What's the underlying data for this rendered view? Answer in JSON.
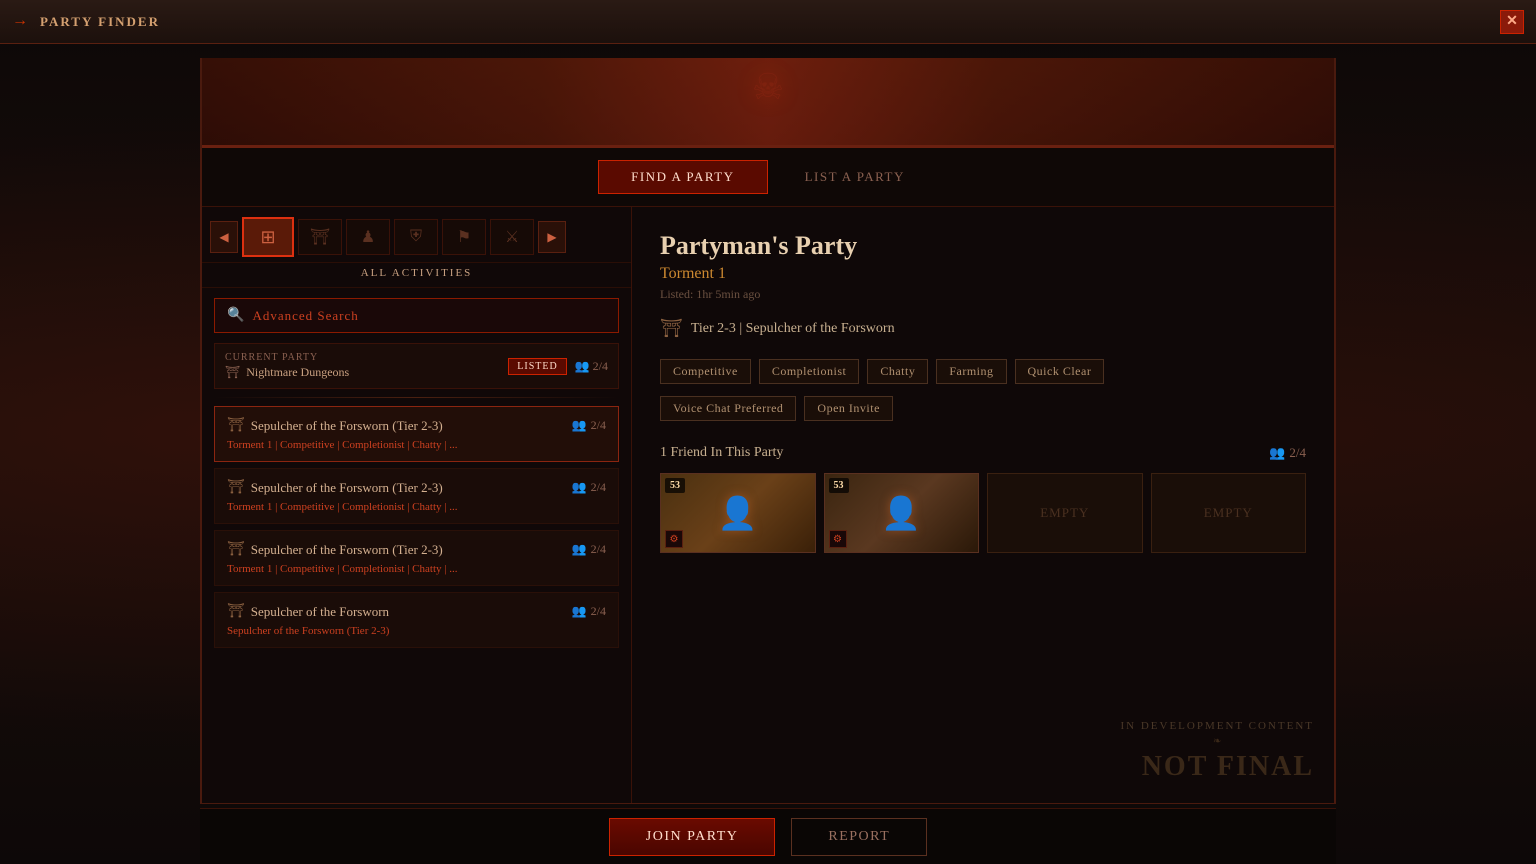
{
  "window": {
    "title": "PARTY FINDER",
    "title_icon": "→"
  },
  "tabs": {
    "find": "FIND A PARTY",
    "list": "LIST A PARTY",
    "active": "find"
  },
  "left_panel": {
    "activity_label": "ALL ACTIVITIES",
    "search_placeholder": "Advanced Search",
    "current_party": {
      "label": "Current Party",
      "name": "Nightmare Dungeons",
      "status": "LISTED",
      "count": "2/4"
    },
    "nav_icons": [
      "◀",
      "⊞",
      "⛩",
      "☗",
      "♟",
      "⚑",
      "⚔",
      "▶"
    ],
    "party_list": [
      {
        "name": "Sepulcher of the Forsworn (Tier 2-3)",
        "count": "2/4",
        "tags": "Torment 1  |  Competitive  |  Completionist  |  Chatty  |  ...",
        "selected": true
      },
      {
        "name": "Sepulcher of the Forsworn (Tier 2-3)",
        "count": "2/4",
        "tags": "Torment 1  |  Competitive  |  Completionist  |  Chatty  |  ...",
        "selected": false
      },
      {
        "name": "Sepulcher of the Forsworn (Tier 2-3)",
        "count": "2/4",
        "tags": "Torment 1  |  Competitive  |  Completionist  |  Chatty  |  ...",
        "selected": false
      },
      {
        "name": "Sepulcher of the Forsworn",
        "count": "2/4",
        "tags": "Sepulcher of the Forsworn (Tier 2-3)",
        "selected": false
      }
    ]
  },
  "right_panel": {
    "party_name": "Partyman's Party",
    "difficulty": "Torment 1",
    "listed_time": "Listed: 1hr 5min ago",
    "dungeon": "Tier 2-3 | Sepulcher of the Forsworn",
    "tags": [
      "Competitive",
      "Completionist",
      "Chatty",
      "Farming",
      "Quick Clear",
      "Voice Chat Preferred",
      "Open Invite"
    ],
    "friends_label": "1 Friend In This Party",
    "party_count": "2/4",
    "members": [
      {
        "filled": true,
        "level": "53",
        "type": "avatar1",
        "empty": false
      },
      {
        "filled": true,
        "level": "53",
        "type": "avatar2",
        "empty": false
      },
      {
        "filled": false,
        "level": "",
        "type": "empty",
        "empty": true,
        "label": "EMPTY"
      },
      {
        "filled": false,
        "level": "",
        "type": "empty",
        "empty": true,
        "label": "EMPTY"
      }
    ]
  },
  "footer": {
    "join_label": "Join Party",
    "report_label": "Report"
  },
  "watermark": {
    "line1": "IN DEVELOPMENT CONTENT",
    "divider": "❧",
    "line2": "NOT FINAL"
  }
}
